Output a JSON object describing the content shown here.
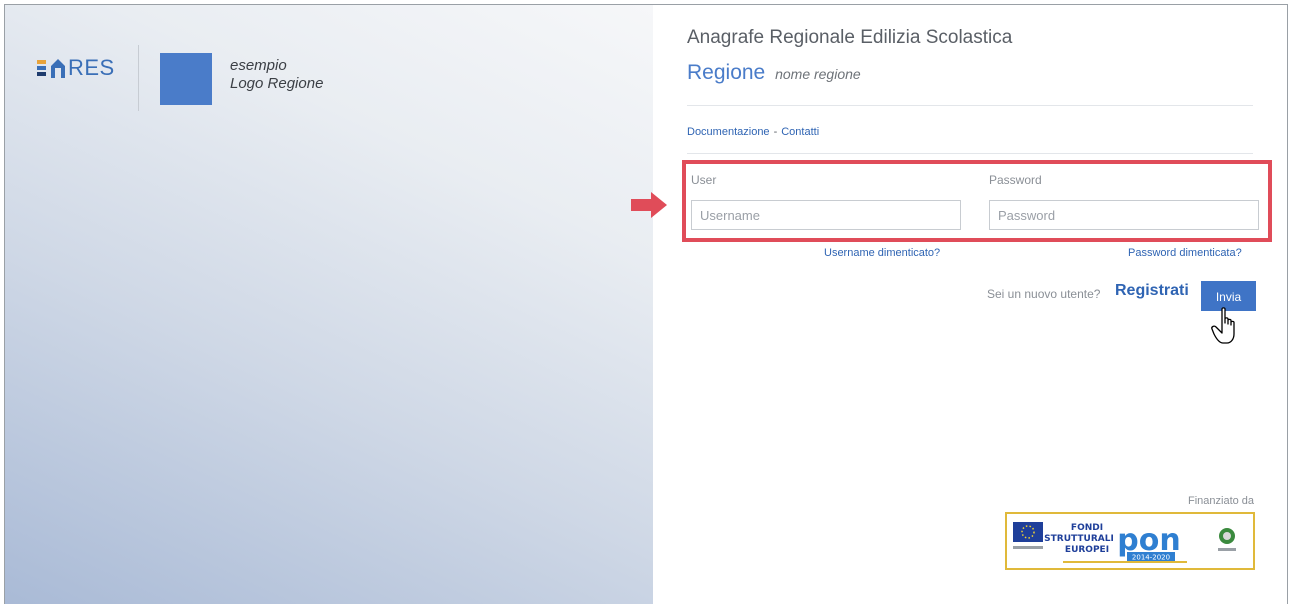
{
  "brand": {
    "ares_label": "RES",
    "region_logo_line1": "esempio",
    "region_logo_line2": "Logo Regione",
    "ares_colors": [
      "#e8a33a",
      "#3a6fb7",
      "#1f3c6e"
    ]
  },
  "header": {
    "title": "Anagrafe Regionale Edilizia Scolastica",
    "region_label": "Regione",
    "region_name": "nome regione"
  },
  "links": {
    "documentation": "Documentazione",
    "separator": "-",
    "contacts": "Contatti"
  },
  "login": {
    "user_label": "User",
    "password_label": "Password",
    "username_placeholder": "Username",
    "password_placeholder": "Password",
    "forgot_username": "Username dimenticato?",
    "forgot_password": "Password dimenticata?",
    "new_user_text": "Sei un nuovo utente?",
    "register_label": "Registrati",
    "submit_label": "Invia"
  },
  "footer": {
    "funded_by": "Finanziato da",
    "funds_line1": "FONDI",
    "funds_line2": "STRUTTURALI",
    "funds_line3": "EUROPEI",
    "pon": "pon",
    "years": "2014-2020"
  },
  "colors": {
    "accent": "#4a7cc9",
    "link": "#2f64b3",
    "highlight": "#e04c59"
  }
}
